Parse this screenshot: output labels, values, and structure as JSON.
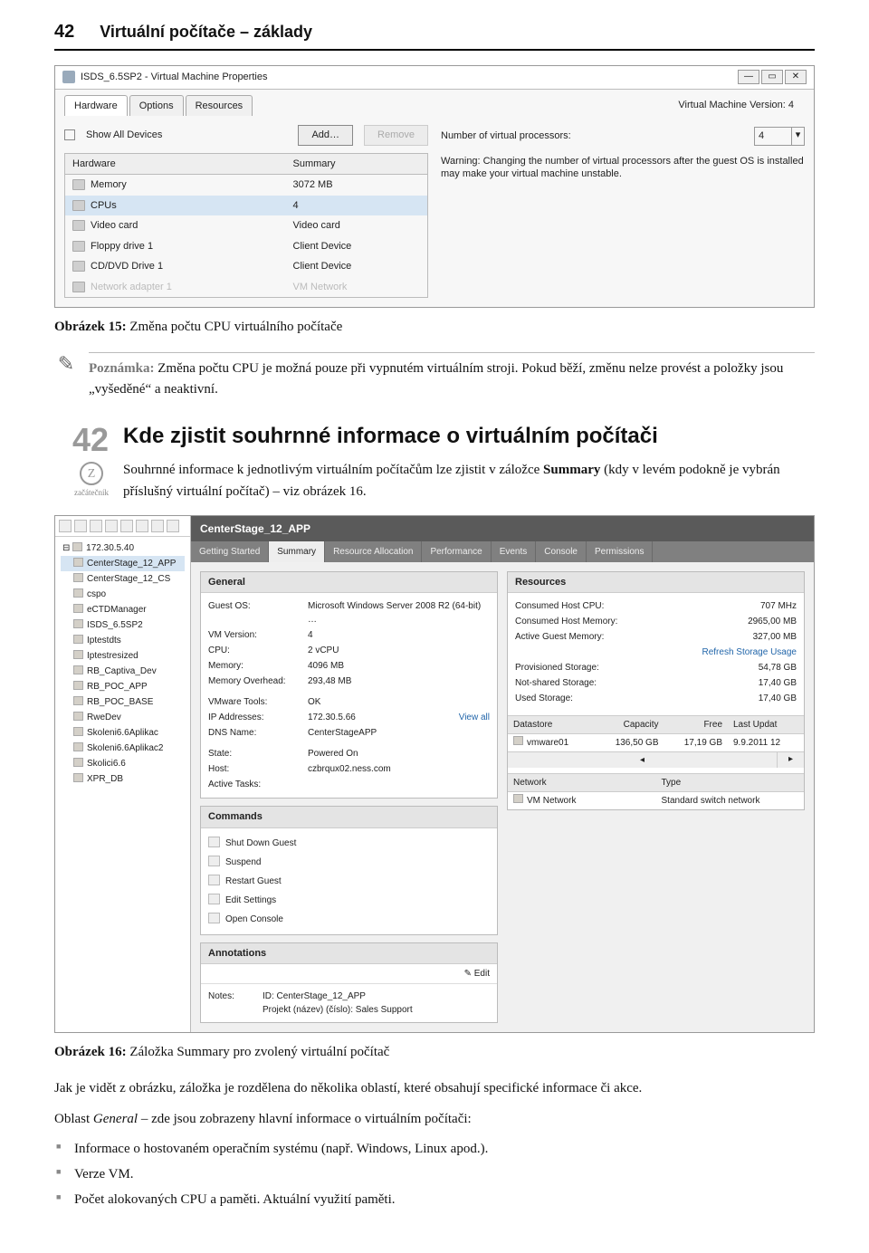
{
  "header": {
    "page_number": "42",
    "chapter_title": "Virtuální počítače – základy"
  },
  "fig15": {
    "window_title": "ISDS_6.5SP2 - Virtual Machine Properties",
    "tabs": [
      "Hardware",
      "Options",
      "Resources"
    ],
    "version_label": "Virtual Machine Version: 4",
    "show_all_label": "Show All Devices",
    "btn_add": "Add…",
    "btn_remove": "Remove",
    "col_hw": "Hardware",
    "col_sum": "Summary",
    "rows": [
      {
        "name": "Memory",
        "sum": "3072 MB"
      },
      {
        "name": "CPUs",
        "sum": "4",
        "selected": true
      },
      {
        "name": "Video card",
        "sum": "Video card"
      },
      {
        "name": "Floppy drive 1",
        "sum": "Client Device"
      },
      {
        "name": "CD/DVD Drive 1",
        "sum": "Client Device"
      },
      {
        "name": "Network adapter 1",
        "sum": "VM Network"
      }
    ],
    "right_label": "Number of virtual processors:",
    "right_value": "4",
    "warning": "Warning: Changing the number of virtual processors after the guest OS is installed may make your virtual machine unstable."
  },
  "caption15": {
    "bold": "Obrázek 15:",
    "text": " Změna počtu CPU virtuálního počítače"
  },
  "note": {
    "label": "Poznámka:",
    "text": " Změna počtu CPU je možná pouze při vypnutém virtuálním stroji. Pokud běží, změnu nelze provést a položky jsou „vyšeděné“ a neaktivní."
  },
  "tip42": {
    "number": "42",
    "badge_label": "začátečník",
    "title": "Kde zjistit souhrnné informace o virtuálním počítači",
    "para_a": "Souhrnné informace k jednotlivým virtuálním počítačům lze zjistit v záložce ",
    "para_bold": "Summary",
    "para_b": " (kdy v levém podokně je vybrán příslušný virtuální počítač) – viz obrázek 16."
  },
  "fig16": {
    "tree_root": "172.30.5.40",
    "tree": [
      "CenterStage_12_APP",
      "CenterStage_12_CS",
      "cspo",
      "eCTDManager",
      "ISDS_6.5SP2",
      "Iptestdts",
      "Iptestresized",
      "RB_Captiva_Dev",
      "RB_POC_APP",
      "RB_POC_BASE",
      "RweDev",
      "Skoleni6.6Aplikac",
      "Skoleni6.6Aplikac2",
      "Skolici6.6",
      "XPR_DB"
    ],
    "main_title": "CenterStage_12_APP",
    "tabs": [
      "Getting Started",
      "Summary",
      "Resource Allocation",
      "Performance",
      "Events",
      "Console",
      "Permissions"
    ],
    "general_h": "General",
    "general": [
      {
        "k": "Guest OS:",
        "v": "Microsoft Windows Server 2008 R2 (64-bit) …"
      },
      {
        "k": "VM Version:",
        "v": "4"
      },
      {
        "k": "CPU:",
        "v": "2 vCPU"
      },
      {
        "k": "Memory:",
        "v": "4096 MB"
      },
      {
        "k": "Memory Overhead:",
        "v": "293,48 MB"
      },
      {
        "k": "VMware Tools:",
        "v": "OK"
      },
      {
        "k": "IP Addresses:",
        "v": "172.30.5.66",
        "extra": "View all"
      },
      {
        "k": "DNS Name:",
        "v": "CenterStageAPP"
      },
      {
        "k": "State:",
        "v": "Powered On"
      },
      {
        "k": "Host:",
        "v": "czbrqux02.ness.com"
      },
      {
        "k": "Active Tasks:",
        "v": ""
      }
    ],
    "commands_h": "Commands",
    "commands": [
      "Shut Down Guest",
      "Suspend",
      "Restart Guest",
      "Edit Settings",
      "Open Console"
    ],
    "annotations_h": "Annotations",
    "edit_label": "Edit",
    "notes_k": "Notes:",
    "notes_line1": "ID: CenterStage_12_APP",
    "notes_line2": "Projekt (název) (číslo): Sales Support",
    "resources_h": "Resources",
    "resources": [
      {
        "k": "Consumed Host CPU:",
        "v": "707 MHz"
      },
      {
        "k": "Consumed Host Memory:",
        "v": "2965,00 MB"
      },
      {
        "k": "Active Guest Memory:",
        "v": "327,00 MB"
      },
      {
        "k": "",
        "v": "Refresh Storage Usage",
        "link": true
      },
      {
        "k": "Provisioned Storage:",
        "v": "54,78 GB"
      },
      {
        "k": "Not-shared Storage:",
        "v": "17,40 GB"
      },
      {
        "k": "Used Storage:",
        "v": "17,40 GB"
      }
    ],
    "ds_headers": [
      "Datastore",
      "Capacity",
      "Free",
      "Last Updat"
    ],
    "ds_row": [
      "vmware01",
      "136,50 GB",
      "17,19 GB",
      "9.9.2011 12"
    ],
    "net_headers": [
      "Network",
      "Type"
    ],
    "net_row": [
      "VM Network",
      "Standard switch network"
    ]
  },
  "caption16": {
    "bold": "Obrázek 16:",
    "text": " Záložka Summary pro zvolený virtuální počítač"
  },
  "para_after": "Jak je vidět z obrázku, záložka je rozdělena do několika oblastí, které obsahují specifické informace či akce.",
  "para_general_a": "Oblast ",
  "para_general_i": "General",
  "para_general_b": " – zde jsou zobrazeny hlavní informace o virtuálním počítači:",
  "bullets": [
    "Informace o hostovaném operačním systému (např. Windows, Linux apod.).",
    "Verze VM.",
    "Počet alokovaných CPU a paměti. Aktuální využití paměti."
  ]
}
